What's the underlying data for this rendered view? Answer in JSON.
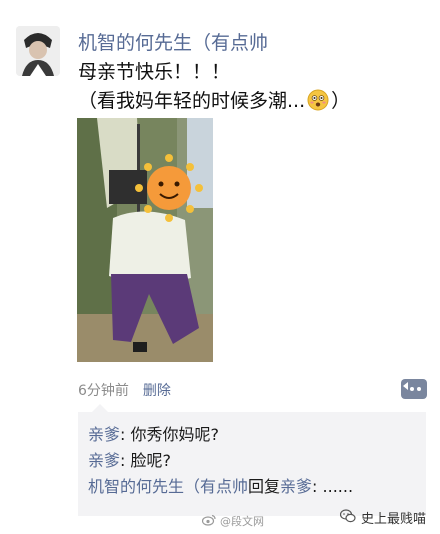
{
  "post": {
    "username": "机智的何先生（有点帅",
    "text_line1": "母亲节快乐！！！",
    "text_line2": "（看我妈年轻的时候多潮...",
    "text_line2_end": "）",
    "emoji": "thinking-face-icon"
  },
  "meta": {
    "time": "6分钟前",
    "delete_label": "删除"
  },
  "comments": [
    {
      "name": "亲爹",
      "sep": ":",
      "text": "你秀你妈呢?"
    },
    {
      "name": "亲爹",
      "sep": ":",
      "text": "脸呢?"
    },
    {
      "name": "机智的何先生（有点帅",
      "reply_word": "回复",
      "target": "亲爹",
      "sep": ":",
      "text": "......"
    }
  ],
  "watermark": {
    "text": "@段文网"
  },
  "brand": {
    "text": "史上最贱喵"
  },
  "colors": {
    "link": "#576b95",
    "comment_bg": "#f3f3f5",
    "meta": "#8c8c8c"
  }
}
